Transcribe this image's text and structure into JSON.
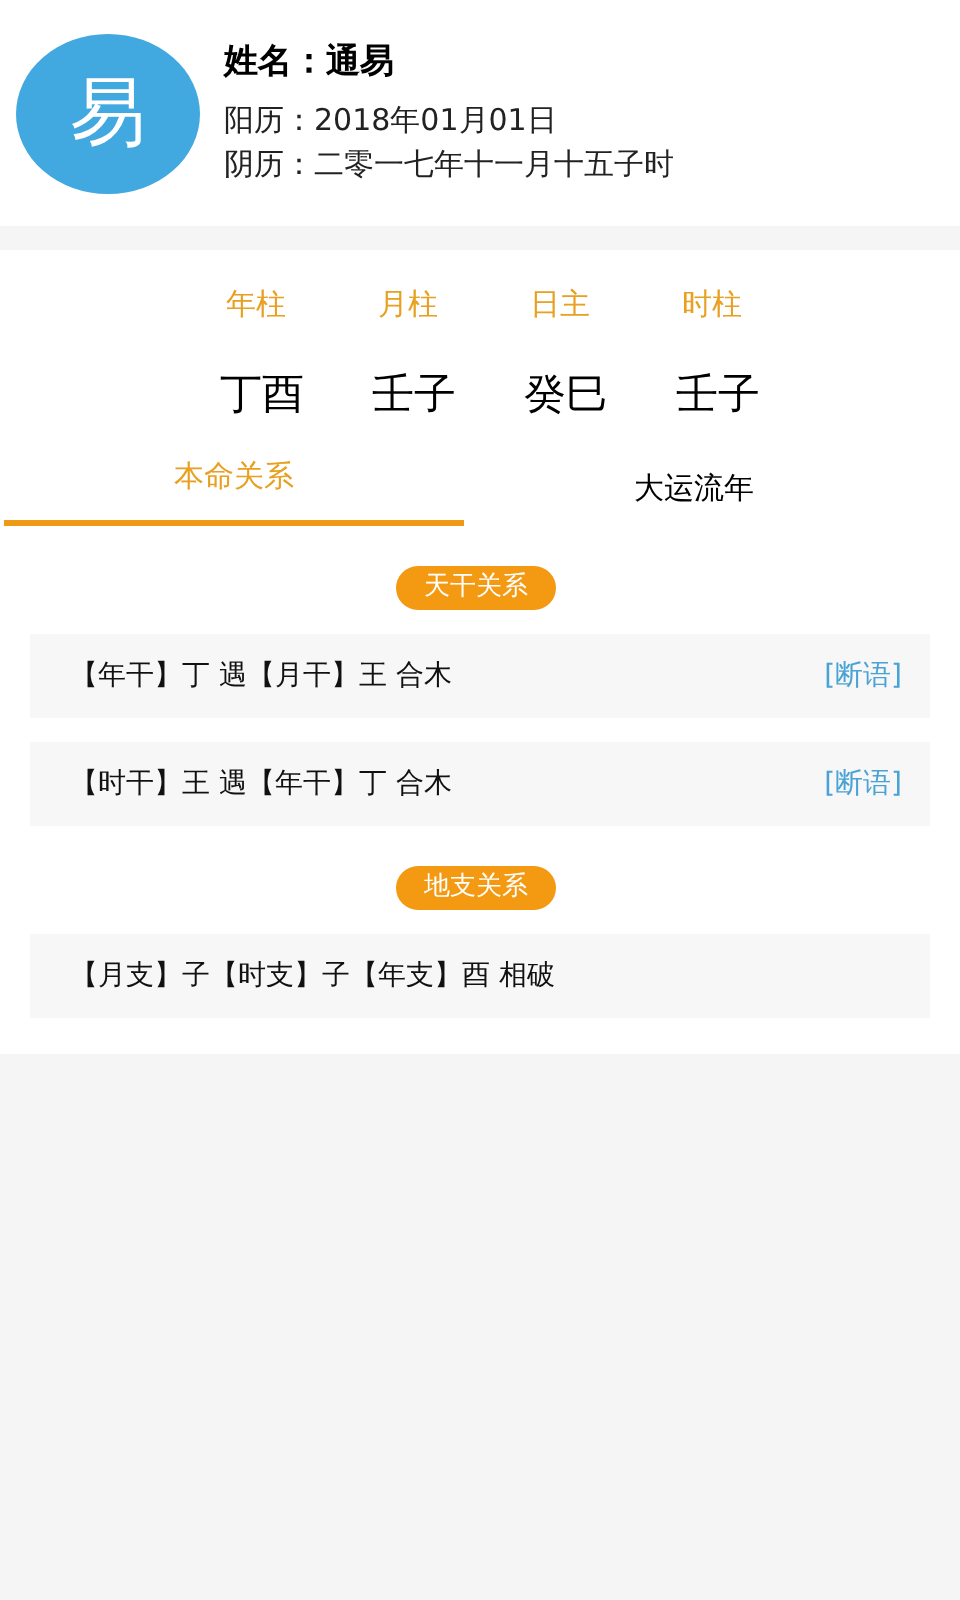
{
  "profile": {
    "avatar": "易",
    "name": "姓名：通易",
    "solar_date": "阳历：2018年01月01日",
    "lunar_date": "阴历：二零一七年十一月十五子时"
  },
  "pillars": [
    {
      "label": "年柱",
      "value": "丁酉"
    },
    {
      "label": "月柱",
      "value": "壬子"
    },
    {
      "label": "日主",
      "value": "癸巳"
    },
    {
      "label": "时柱",
      "value": "壬子"
    }
  ],
  "tabs": [
    {
      "label": "本命关系",
      "selected": true
    },
    {
      "label": "大运流年",
      "selected": false
    }
  ],
  "sections": [
    {
      "title": "天干关系",
      "items": [
        {
          "text": "【年干】丁 遇【月干】王 合木",
          "link": "[断语]"
        },
        {
          "text": "【时干】王 遇【年干】丁 合木",
          "link": "[断语]"
        }
      ]
    },
    {
      "title": "地支关系",
      "items": [
        {
          "text": "【月支】子【时支】子【年支】酉 相破"
        }
      ]
    }
  ]
}
